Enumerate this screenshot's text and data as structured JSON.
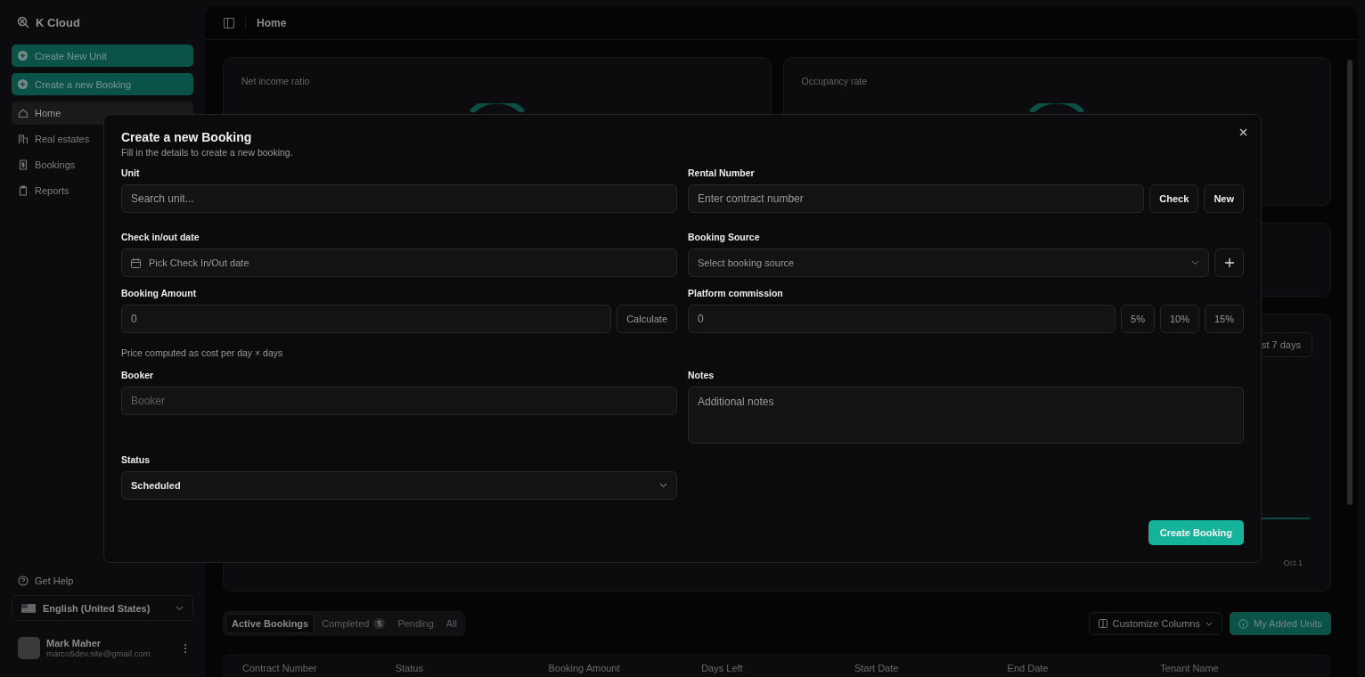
{
  "sidebar": {
    "brand": "K Cloud",
    "actions": [
      "Create New Unit",
      "Create a new Booking"
    ],
    "nav": [
      {
        "label": "Home",
        "selected": true
      },
      {
        "label": "Real estates",
        "selected": false
      },
      {
        "label": "Bookings",
        "selected": false
      },
      {
        "label": "Reports",
        "selected": false
      }
    ],
    "help": "Get Help",
    "language": "English (United States)",
    "user": {
      "name": "Mark Maher",
      "email": "marco5dev.site@gmail.com"
    }
  },
  "topbar": {
    "title": "Home"
  },
  "dashboard": {
    "cards": [
      {
        "title": "Net income ratio"
      },
      {
        "title": "Occupancy rate"
      }
    ],
    "range_button": "st 7 days",
    "chart_axis_label": "Oct 1",
    "tabs": [
      {
        "label": "Active Bookings",
        "selected": true
      },
      {
        "label": "Completed",
        "count": "5",
        "selected": false
      },
      {
        "label": "Pending",
        "selected": false
      },
      {
        "label": "All",
        "selected": false
      }
    ],
    "customize_button": "Customize Columns",
    "added_units_button": "My Added Units",
    "table_columns": [
      "Contract Number",
      "Status",
      "Booking Amount",
      "Days Left",
      "Start Date",
      "End Date",
      "Tenant Name"
    ]
  },
  "modal": {
    "title": "Create a new Booking",
    "subtitle": "Fill in the details to create a new booking.",
    "unit": {
      "label": "Unit",
      "placeholder": "Search unit..."
    },
    "rental_number": {
      "label": "Rental Number",
      "placeholder": "Enter contract number",
      "buttons": [
        "Check",
        "New"
      ]
    },
    "dates": {
      "label": "Check in/out date",
      "placeholder": "Pick Check In/Out date"
    },
    "booking_source": {
      "label": "Booking Source",
      "placeholder": "Select booking source"
    },
    "booking_amount": {
      "label": "Booking Amount",
      "value": "0",
      "button": "Calculate",
      "hint": "Price computed as cost per day × days"
    },
    "platform_commission": {
      "label": "Platform commission",
      "value": "0",
      "presets": [
        "5%",
        "10%",
        "15%"
      ]
    },
    "booker": {
      "label": "Booker",
      "placeholder": "Booker"
    },
    "notes": {
      "label": "Notes",
      "placeholder": "Additional notes"
    },
    "status": {
      "label": "Status",
      "value": "Scheduled"
    },
    "submit": "Create Booking"
  }
}
